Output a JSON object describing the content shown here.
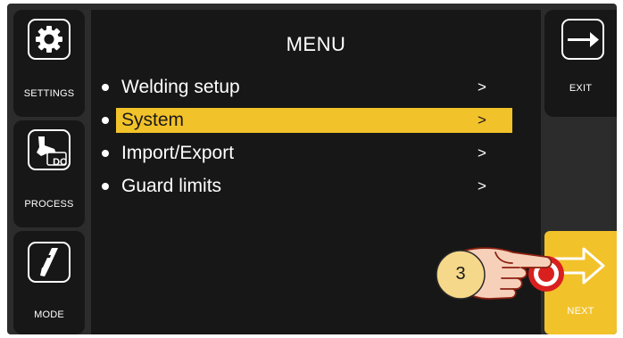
{
  "screen": {
    "title": "MENU"
  },
  "left_buttons": [
    {
      "label": "SETTINGS",
      "icon": "gear-icon"
    },
    {
      "label": "PROCESS",
      "icon": "welding-torch-icon",
      "badge": "DC"
    },
    {
      "label": "MODE",
      "icon": "torch-trigger-icon"
    }
  ],
  "right_buttons": [
    {
      "label": "EXIT",
      "icon": "exit-arrow-icon"
    },
    {
      "label": "NEXT",
      "icon": "next-arrow-icon"
    }
  ],
  "menu": {
    "items": [
      {
        "label": "Welding setup",
        "arrow": ">"
      },
      {
        "label": "System",
        "arrow": ">",
        "selected": true
      },
      {
        "label": "Import/Export",
        "arrow": ">"
      },
      {
        "label": "Guard limits",
        "arrow": ">"
      }
    ]
  },
  "callout": {
    "step": "3"
  },
  "colors": {
    "accent": "#f2c22a",
    "panel": "#171717",
    "bezel": "#2c2c2c",
    "touch_ring": "#d9201e"
  }
}
